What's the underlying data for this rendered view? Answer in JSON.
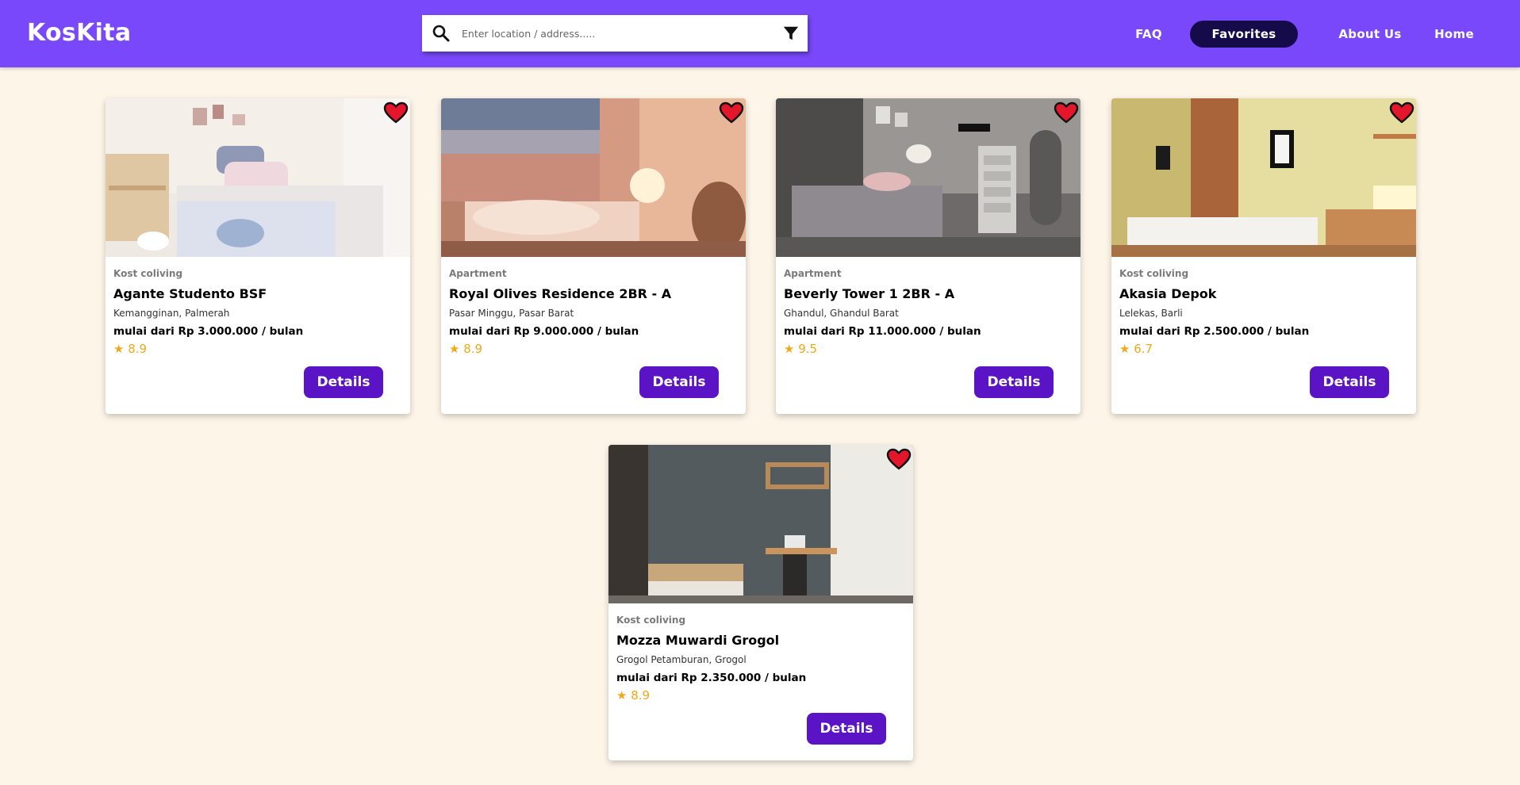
{
  "brand": {
    "name": "KosKita"
  },
  "search": {
    "placeholder": "Enter location / address.....",
    "value": ""
  },
  "nav": {
    "faq": "FAQ",
    "favorites": "Favorites",
    "about": "About Us",
    "home": "Home"
  },
  "colors": {
    "header": "#7848fa",
    "page_background": "#fdf5e8",
    "active_nav": "#150a4a",
    "button": "#5a14c6",
    "rating": "#f0a81a",
    "heart": "#e3162b"
  },
  "listings": [
    {
      "type": "Kost coliving",
      "name": "Agante Studento BSF",
      "location": "Kemangginan, Palmerah",
      "price": "mulai dari Rp 3.000.000 / bulan",
      "rating": "★ 8.9",
      "button": "Details",
      "favorited": true,
      "icon": "heart-icon"
    },
    {
      "type": "Apartment",
      "name": "Royal Olives Residence 2BR - A",
      "location": "Pasar Minggu, Pasar Barat",
      "price": "mulai dari Rp 9.000.000 / bulan",
      "rating": "★ 8.9",
      "button": "Details",
      "favorited": true,
      "icon": "heart-icon"
    },
    {
      "type": "Apartment",
      "name": "Beverly Tower 1 2BR - A",
      "location": "Ghandul, Ghandul Barat",
      "price": "mulai dari Rp 11.000.000 / bulan",
      "rating": "★ 9.5",
      "button": "Details",
      "favorited": true,
      "icon": "heart-icon"
    },
    {
      "type": "Kost coliving",
      "name": "Akasia Depok",
      "location": "Lelekas, Barli",
      "price": "mulai dari Rp 2.500.000 / bulan",
      "rating": "★ 6.7",
      "button": "Details",
      "favorited": true,
      "icon": "heart-icon"
    },
    {
      "type": "Kost coliving",
      "name": "Mozza Muwardi Grogol",
      "location": "Grogol Petamburan, Grogol",
      "price": "mulai dari Rp 2.350.000 / bulan",
      "rating": "★ 8.9",
      "button": "Details",
      "favorited": true,
      "icon": "heart-icon"
    }
  ]
}
